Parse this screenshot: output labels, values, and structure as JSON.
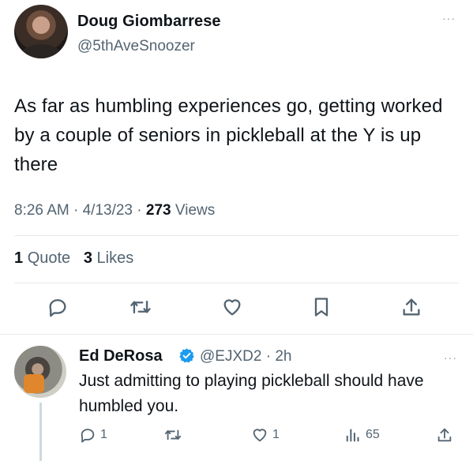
{
  "tweet": {
    "author_name": "Doug Giombarrese",
    "author_handle": "@5thAveSnoozer",
    "text": "As far as humbling experiences go, getting worked by a couple of seniors in pickleball at the Y is up there",
    "time": "8:26 AM",
    "date": "4/13/23",
    "separator": "·",
    "views_count": "273",
    "views_label": "Views",
    "quotes_count": "1",
    "quotes_label": "Quote",
    "likes_count": "3",
    "likes_label": "Likes",
    "more_label": "···"
  },
  "reply": {
    "author_name": "Ed DeRosa",
    "author_handle": "@EJXD2",
    "separator": "·",
    "age": "2h",
    "text": "Just admitting to playing pickleball should have humbled you.",
    "reply_count": "1",
    "like_count": "1",
    "view_count": "65",
    "more_label": "···"
  },
  "colors": {
    "text_primary": "#0f1419",
    "text_secondary": "#536471",
    "divider": "#e7e9ea",
    "verified_blue": "#1d9bf0"
  },
  "icons": {
    "actions": [
      "reply-icon",
      "retweet-icon",
      "like-icon",
      "bookmark-icon",
      "share-icon"
    ],
    "reply_actions": [
      "reply-icon",
      "retweet-icon",
      "like-icon",
      "views-icon",
      "share-icon"
    ]
  }
}
